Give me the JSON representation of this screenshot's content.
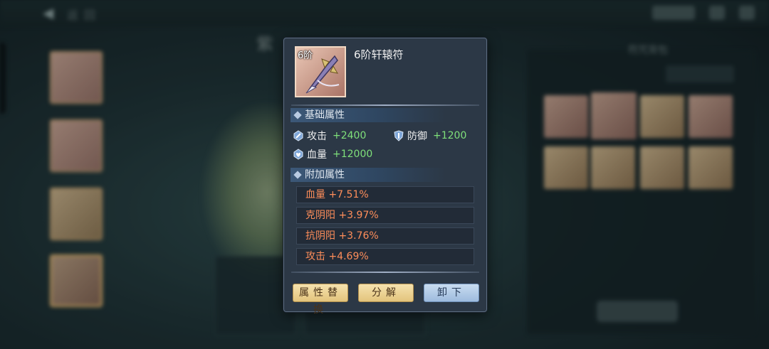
{
  "background": {
    "top_title": "返回",
    "center_title": "紫",
    "right_panel_title": "符咒背包"
  },
  "item": {
    "tier_badge": "6阶",
    "name": "6阶轩辕符"
  },
  "base_section": {
    "title": "基础属性",
    "stats": [
      {
        "icon": "attack-icon",
        "label": "攻击",
        "value": "+2400"
      },
      {
        "icon": "defense-icon",
        "label": "防御",
        "value": "+1200"
      },
      {
        "icon": "hp-icon",
        "label": "血量",
        "value": "+12000"
      }
    ]
  },
  "extra_section": {
    "title": "附加属性",
    "stats": [
      {
        "label": "血量",
        "value": "+7.51%"
      },
      {
        "label": "克阴阳",
        "value": "+3.97%"
      },
      {
        "label": "抗阴阳",
        "value": "+3.76%"
      },
      {
        "label": "攻击",
        "value": "+4.69%"
      }
    ]
  },
  "buttons": {
    "replace": "属性替换",
    "decompose": "分解",
    "unequip": "卸下"
  },
  "colors": {
    "popup_bg": "#2c3846",
    "positive_green": "#7fe07a",
    "extra_orange": "#ff8e5a",
    "gold_button": "#e3c47d",
    "blue_button": "#9ebbde"
  }
}
